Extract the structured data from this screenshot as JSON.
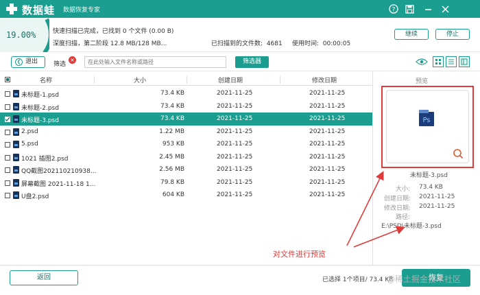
{
  "app": {
    "name": "数据蛙",
    "subtitle": "数据恢复专家"
  },
  "titlebar_icons": [
    "help-icon",
    "save-icon",
    "minimize-icon",
    "close-icon"
  ],
  "progress": {
    "percent_text": "19.00%",
    "percent": 19.0,
    "status_line1": "快速扫描已完成，已找到 0 个文件 (0.00  B)",
    "status_line2": "深度扫描，第二阶段 12.8 MB/128 MB...",
    "found_label": "已扫描到的文件数:",
    "found_value": "4681",
    "time_label": "使用时间:",
    "time_value": "00:00:05",
    "continue_label": "继续",
    "stop_label": "停止"
  },
  "toolbar": {
    "back_label": "退出",
    "filter_label": "筛选",
    "search_placeholder": "在此处输入文件名称或路径",
    "filter_button_label": "筛选器"
  },
  "table": {
    "headers": {
      "name": "名称",
      "size": "大小",
      "created": "创建日期",
      "modified": "修改日期"
    },
    "rows": [
      {
        "name": "未标题-1.psd",
        "size": "73.4 KB",
        "created": "2021-11-25",
        "modified": "2021-11-25",
        "checked": false,
        "selected": false
      },
      {
        "name": "未标题-2.psd",
        "size": "73.4 KB",
        "created": "2021-11-25",
        "modified": "2021-11-25",
        "checked": false,
        "selected": false
      },
      {
        "name": "未标题-3.psd",
        "size": "73.4 KB",
        "created": "2021-11-25",
        "modified": "2021-11-25",
        "checked": true,
        "selected": true
      },
      {
        "name": "2.psd",
        "size": "1.22 MB",
        "created": "2021-11-25",
        "modified": "2021-11-25",
        "checked": false,
        "selected": false
      },
      {
        "name": "5.psd",
        "size": "953 KB",
        "created": "2021-11-25",
        "modified": "2021-11-25",
        "checked": false,
        "selected": false
      },
      {
        "name": "1021 插图2.psd",
        "size": "2.45 MB",
        "created": "2021-11-25",
        "modified": "2021-11-25",
        "checked": false,
        "selected": false
      },
      {
        "name": "QQ截图202110210938...",
        "size": "2.56 MB",
        "created": "2021-11-25",
        "modified": "2021-11-25",
        "checked": false,
        "selected": false
      },
      {
        "name": "屏幕截图 2021-11-18 1...",
        "size": "79.8 KB",
        "created": "2021-11-25",
        "modified": "2021-11-25",
        "checked": false,
        "selected": false
      },
      {
        "name": "U盘2.psd",
        "size": "604 KB",
        "created": "2021-11-25",
        "modified": "2021-11-25",
        "checked": false,
        "selected": false
      }
    ]
  },
  "preview": {
    "title": "预览",
    "file_name": "未标题-3.psd",
    "size_label": "大小:",
    "size_value": "73.4 KB",
    "created_label": "创建日期:",
    "created_value": "2021-11-25",
    "modified_label": "修改日期:",
    "modified_value": "2021-11-25",
    "path_label": "路径:",
    "path_value": "E:\\PSD\\未标题-3.psd",
    "icon_badge": "Ps"
  },
  "annotation": "对文件进行预览",
  "footer": {
    "return_label": "返回",
    "selected_info": "已选择 1个项目/ 73.4 KB",
    "recover_label": "恢复",
    "watermark": "@稀土掘金技术社区"
  },
  "colors": {
    "accent": "#1b9e8f",
    "annotation": "#e03a3a"
  }
}
